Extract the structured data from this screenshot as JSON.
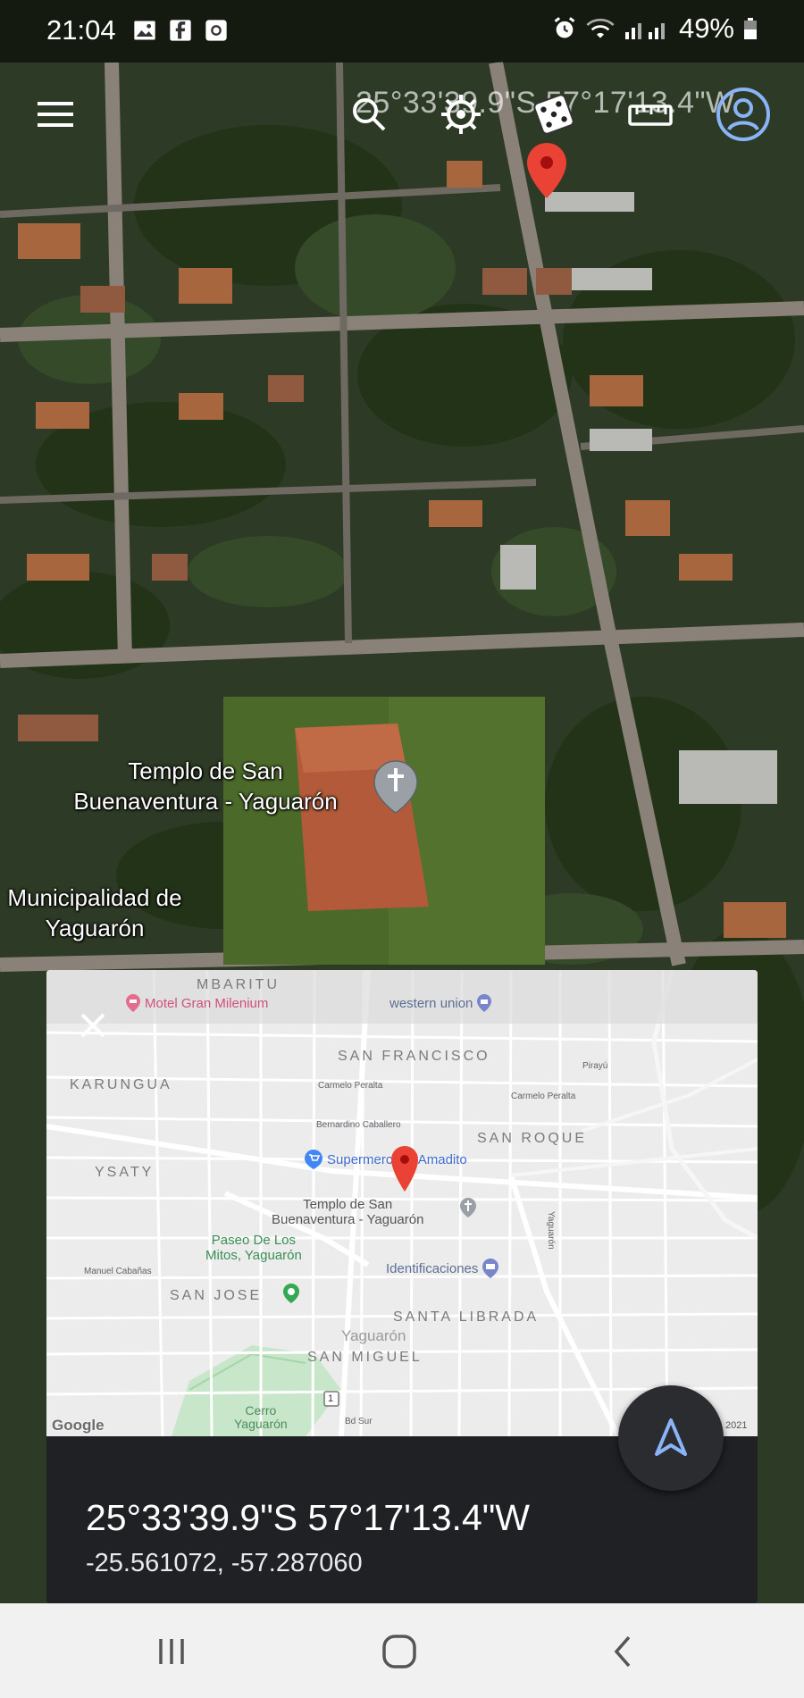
{
  "status_bar": {
    "time": "21:04",
    "battery": "49%",
    "left_icons": [
      "gallery-icon",
      "facebook-icon",
      "instagram-icon"
    ],
    "right_icons": [
      "alarm-icon",
      "wifi-icon",
      "signal-icon",
      "battery-icon"
    ]
  },
  "toolbar": {
    "coordinates_overlay": "25°33'39.9\"S 57°17'13.4\"W",
    "icons": [
      "menu-icon",
      "search-icon",
      "voyager-icon",
      "feeling-lucky-dice-icon",
      "measure-ruler-icon",
      "account-icon"
    ]
  },
  "satellite_labels": {
    "church": "Templo de San Buenaventura - Yaguarón",
    "municipality": "Municipalidad de Yaguarón"
  },
  "mini_map": {
    "districts": [
      "MBARITU",
      "SAN FRANCISCO",
      "KARUNGUA",
      "SAN ROQUE",
      "YSATY",
      "SAN JOSE",
      "SANTA LIBRADA",
      "SAN MIGUEL"
    ],
    "streets": [
      "Carmelo Peralta",
      "Carmelo Peralta",
      "Bernardino Caballero",
      "Manuel Cabañas",
      "Pirayú",
      "Yaguarón",
      "Bd Sur"
    ],
    "pois": {
      "motel": "Motel Gran Milenium",
      "western_union": "western union",
      "supermarket": "Supermercado Amadito",
      "church_line1": "Templo de San",
      "church_line2": "Buenaventura - Yaguarón",
      "park_line1": "Paseo De Los",
      "park_line2": "Mitos, Yaguarón",
      "identifications": "Identificaciones",
      "town": "Yaguarón",
      "hill_line1": "Cerro",
      "hill_line2": "Yaguarón"
    },
    "route_number": "1",
    "logo": "Google",
    "copyright_year": "2021"
  },
  "location_card": {
    "coordinates_dms": "25°33'39.9\"S 57°17'13.4\"W",
    "coordinates_decimal": "-25.561072, -57.287060"
  },
  "colors": {
    "accent_blue": "#8ab4f8",
    "pin_red": "#ea4335",
    "card_bg": "#202124"
  }
}
